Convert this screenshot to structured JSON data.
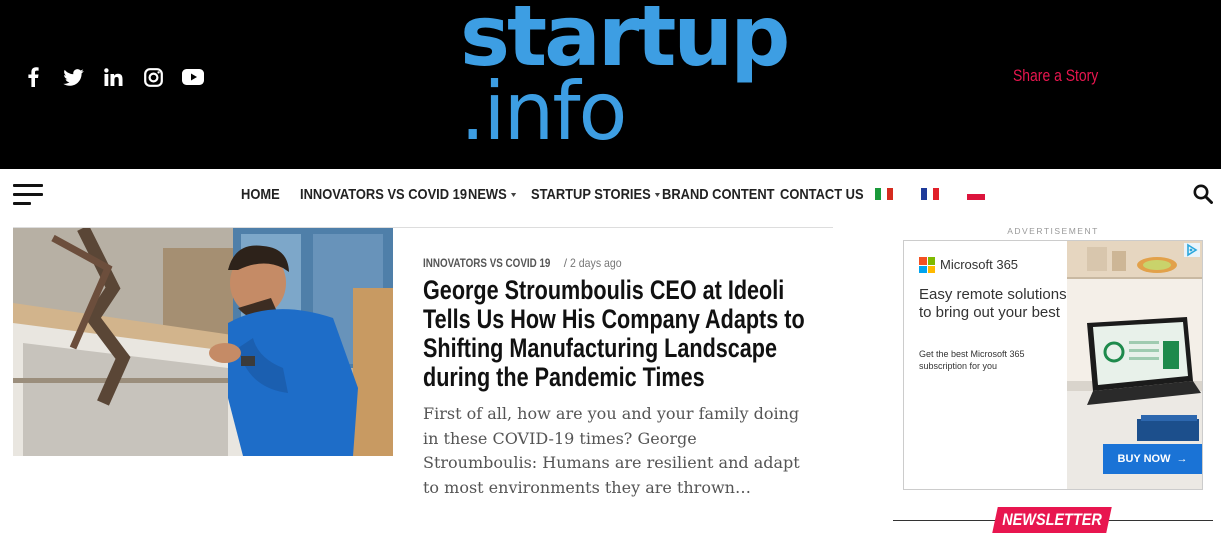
{
  "header": {
    "social": [
      "facebook-icon",
      "twitter-icon",
      "linkedin-icon",
      "instagram-icon",
      "youtube-icon"
    ],
    "logo": {
      "line1": "startup",
      "line2": ".info",
      "color": "#3d9ee3"
    },
    "share_story": "Share a Story",
    "accent_color": "#e8164f"
  },
  "nav": {
    "items": [
      {
        "label": "HOME",
        "dropdown": false
      },
      {
        "label": "INNOVATORS VS COVID 19",
        "dropdown": false
      },
      {
        "label": "NEWS",
        "dropdown": true
      },
      {
        "label": "STARTUP STORIES",
        "dropdown": true
      },
      {
        "label": "BRAND CONTENT",
        "dropdown": false
      },
      {
        "label": "CONTACT US",
        "dropdown": false
      }
    ],
    "flags": [
      "italy-flag-icon",
      "france-flag-icon",
      "poland-flag-icon"
    ]
  },
  "article": {
    "category": "INNOVATORS VS COVID 19",
    "separator": "/",
    "time": "2 days ago",
    "headline": "George Stroumboulis CEO at Ideoli Tells Us How His Company Adapts to Shifting Manufacturing Landscape during the Pandemic Times",
    "excerpt": "First of all, how are you and your family doing in these COVID-19 times?  George Stroumboulis: Humans are resilient and adapt to most environments they are thrown…"
  },
  "sidebar": {
    "ad_label": "ADVERTISEMENT",
    "ad": {
      "brand": "Microsoft 365",
      "heading": "Easy remote solutions to bring out your best",
      "subtext": "Get the best Microsoft 365 subscription for you",
      "button": "BUY NOW",
      "button_arrow": "→"
    },
    "newsletter": "NEWSLETTER"
  }
}
